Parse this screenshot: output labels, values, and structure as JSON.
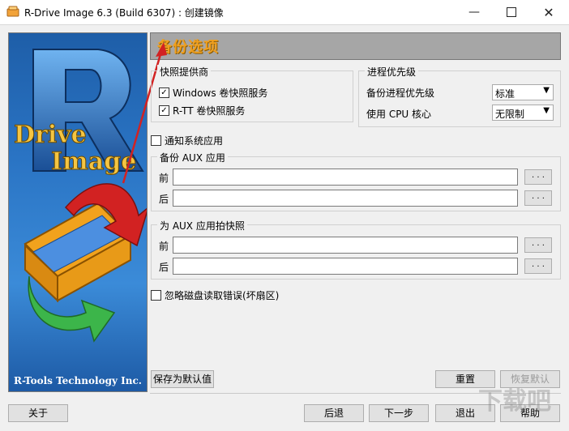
{
  "window": {
    "title": "R-Drive Image 6.3 (Build 6307) : 创建镜像"
  },
  "banner": {
    "company": "R-Tools Technology Inc."
  },
  "header": {
    "title": "备份选项"
  },
  "providers": {
    "label": "快照提供商",
    "items": [
      {
        "label": "Windows 卷快照服务",
        "checked": true
      },
      {
        "label": "R-TT 卷快照服务",
        "checked": true
      }
    ]
  },
  "priority": {
    "label": "进程优先级",
    "backup_priority_label": "备份进程优先级",
    "backup_priority_value": "标准",
    "cpu_cores_label": "使用 CPU 核心",
    "cpu_cores_value": "无限制"
  },
  "notify": {
    "label": "通知系统应用",
    "checked": false
  },
  "backup_aux": {
    "label": "备份 AUX 应用",
    "before_label": "前",
    "after_label": "后",
    "before_value": "",
    "after_value": ""
  },
  "snapshot_aux": {
    "label": "为 AUX 应用拍快照",
    "before_label": "前",
    "after_label": "后",
    "before_value": "",
    "after_value": ""
  },
  "ignore_errors": {
    "label": "忽略磁盘读取错误(坏扇区)",
    "checked": false
  },
  "browse_label": ". . .",
  "buttons": {
    "save_default": "保存为默认值",
    "reset": "重置",
    "restore_default": "恢复默认",
    "about": "关于",
    "back": "后退",
    "next": "下一步",
    "exit": "退出",
    "help": "帮助"
  },
  "watermark": "下载吧",
  "colors": {
    "header_text": "#f0a020",
    "banner_blue": "#2a74c4",
    "arrow_red": "#d22222"
  }
}
